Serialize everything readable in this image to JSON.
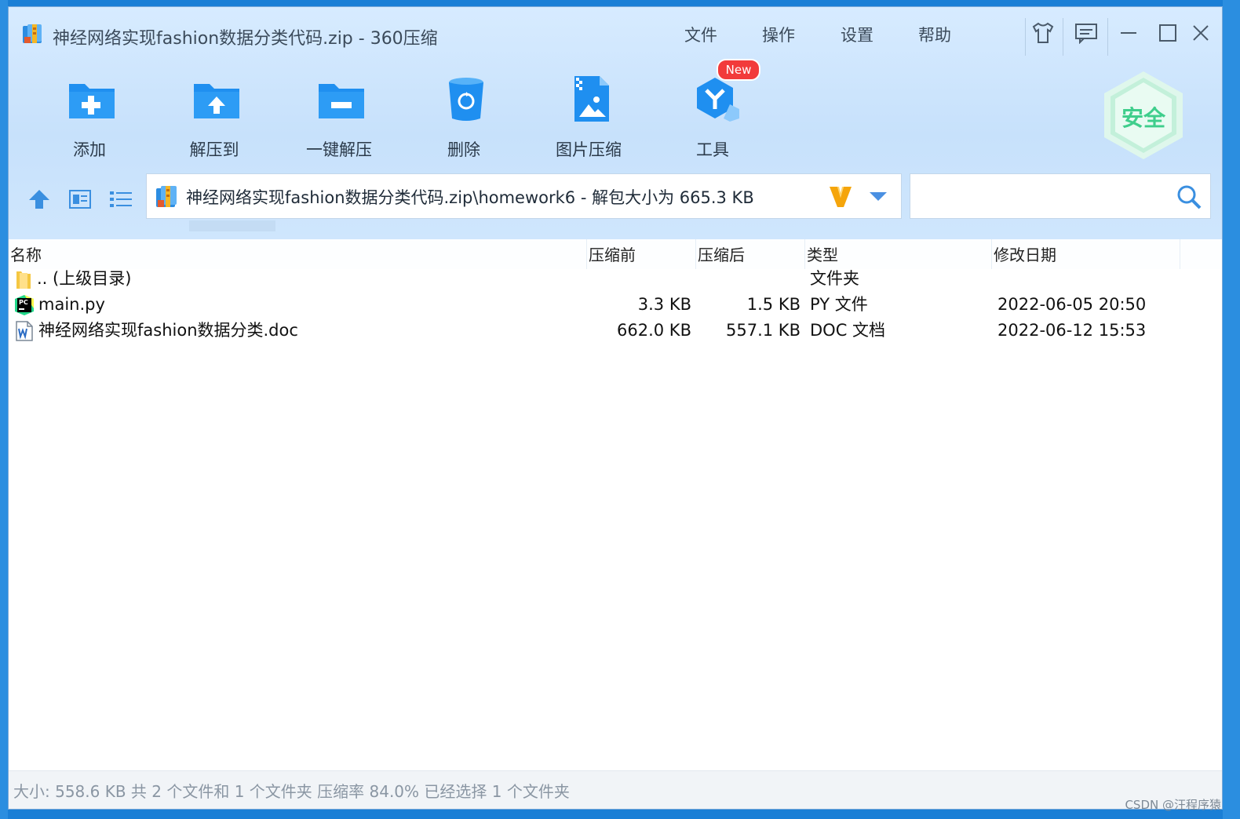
{
  "window": {
    "title": "神经网络实现fashion数据分类代码.zip - 360压缩",
    "menu": [
      "文件",
      "操作",
      "设置",
      "帮助"
    ]
  },
  "toolbar": {
    "items": [
      {
        "label": "添加",
        "icon": "folder-add-icon"
      },
      {
        "label": "解压到",
        "icon": "folder-extract-icon"
      },
      {
        "label": "一键解压",
        "icon": "folder-oneclick-extract-icon"
      },
      {
        "label": "删除",
        "icon": "trash-icon"
      },
      {
        "label": "图片压缩",
        "icon": "image-compress-icon"
      },
      {
        "label": "工具",
        "icon": "tools-icon"
      }
    ],
    "new_badge": "New",
    "safe_badge": "安全"
  },
  "address": {
    "path": "神经网络实现fashion数据分类代码.zip\\homework6 - 解包大小为 665.3 KB"
  },
  "columns": [
    "名称",
    "压缩前",
    "压缩后",
    "类型",
    "修改日期"
  ],
  "files": [
    {
      "name": ".. (上级目录)",
      "before": "",
      "after": "",
      "type": "文件夹",
      "modified": "",
      "icon": "folder-icon"
    },
    {
      "name": "main.py",
      "before": "3.3 KB",
      "after": "1.5 KB",
      "type": "PY 文件",
      "modified": "2022-06-05 20:50",
      "icon": "pycharm-file-icon"
    },
    {
      "name": "神经网络实现fashion数据分类.doc",
      "before": "662.0 KB",
      "after": "557.1 KB",
      "type": "DOC 文档",
      "modified": "2022-06-12 15:53",
      "icon": "word-doc-icon"
    }
  ],
  "status": "大小: 558.6 KB 共 2 个文件和 1 个文件夹 压缩率 84.0% 已经选择 1 个文件夹",
  "watermark": "CSDN @汪程序猿",
  "colors": {
    "accent": "#2b90e8",
    "window_bg": "#ffffff",
    "toolbar_bg": "#cfe6fd",
    "badge_red": "#f23b3b",
    "safe_green": "#3fce8c"
  }
}
